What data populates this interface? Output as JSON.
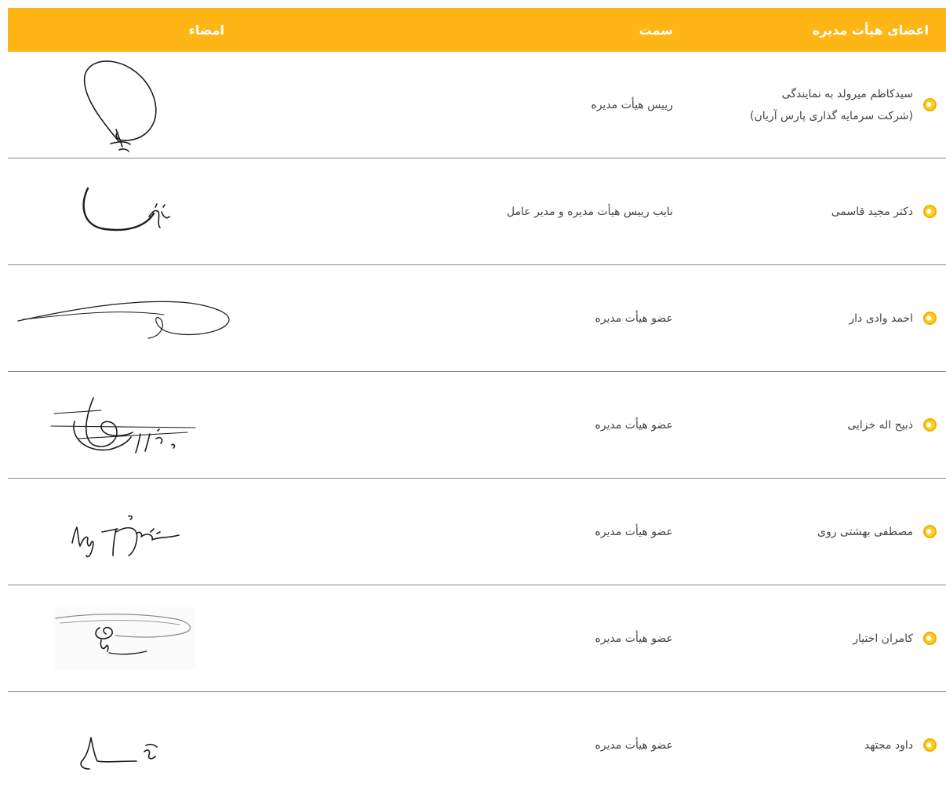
{
  "table": {
    "headers": {
      "member": "اعضای هیأت مدیره",
      "role": "سمت",
      "signature": "امضاء"
    },
    "rows": [
      {
        "name": "سیدکاظم میرولد به نمایندگی",
        "name_line2": "(شرکت سرمایه گذاری پارس آریان)",
        "role": "رییس هیأت مدیره"
      },
      {
        "name": "دکتر مجید قاسمی",
        "role": "نایب رییس هیأت مدیره و مدیر عامل"
      },
      {
        "name": "احمد وادی دار",
        "role": "عضو هیأت مدیره"
      },
      {
        "name": "ذبیح اله خزایی",
        "role": "عضو هیأت مدیره"
      },
      {
        "name": "مصطفی بهشتی روی",
        "role": "عضو هیأت مدیره"
      },
      {
        "name": "کامران اختیار",
        "role": "عضو هیأت مدیره"
      },
      {
        "name": "داود مجتهد",
        "role": "عضو هیأت مدیره"
      }
    ]
  },
  "colors": {
    "header_bg": "#fdb615",
    "bullet": "#ffcc22",
    "divider": "#8a8a8a"
  },
  "icons": {
    "row_marker": "bullet-circle-icon",
    "signature": "handwritten-signature"
  }
}
